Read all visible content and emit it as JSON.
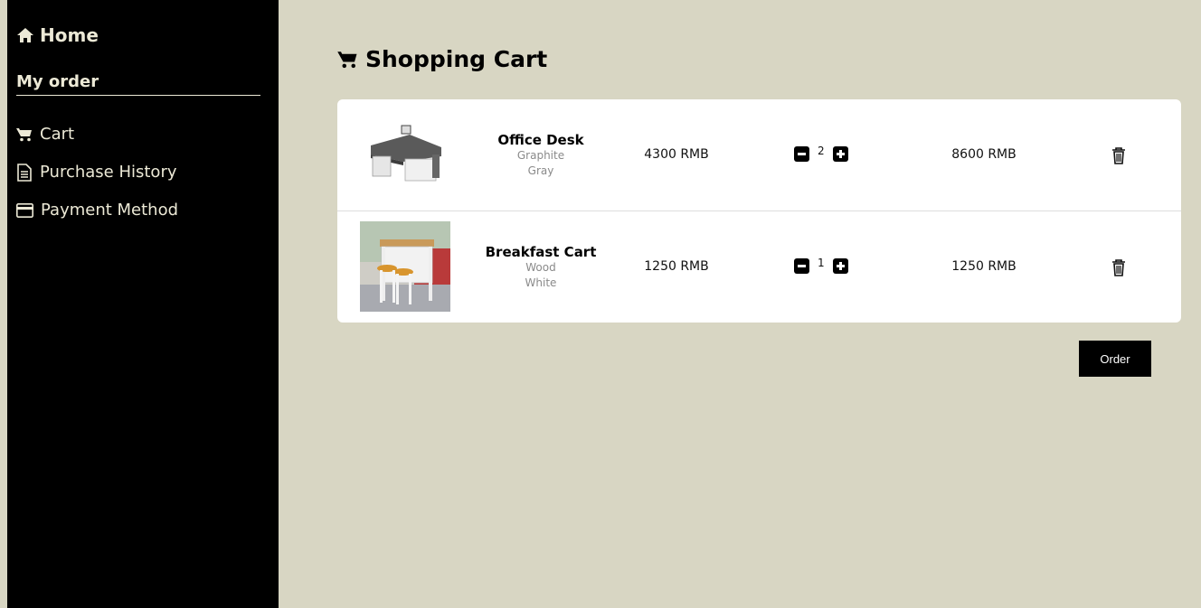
{
  "sidebar": {
    "home_label": "Home",
    "section_title": "My order",
    "items": [
      {
        "label": "Cart",
        "icon": "cart-icon"
      },
      {
        "label": "Purchase History",
        "icon": "document-icon"
      },
      {
        "label": "Payment Method",
        "icon": "credit-card-icon"
      }
    ]
  },
  "main": {
    "title": "Shopping Cart",
    "order_label": "Order",
    "cart": [
      {
        "name": "Office Desk",
        "material": "Graphite",
        "color": "Gray",
        "price": "4300 RMB",
        "quantity": "2",
        "total": "8600 RMB"
      },
      {
        "name": "Breakfast Cart",
        "material": "Wood",
        "color": "White",
        "price": "1250 RMB",
        "quantity": "1",
        "total": "1250 RMB"
      }
    ]
  }
}
